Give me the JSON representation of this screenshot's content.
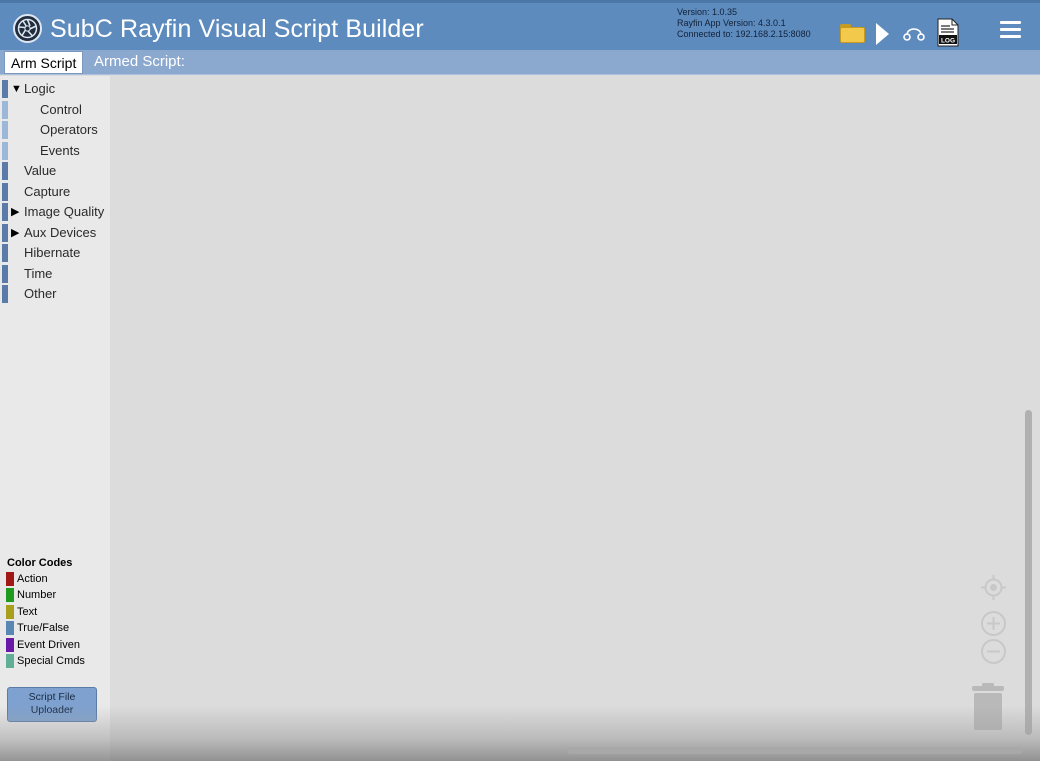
{
  "header": {
    "title": "SubC Rayfin Visual Script Builder",
    "version": "Version: 1.0.35",
    "app_version": "Rayfin App Version: 4.3.0.1",
    "connected_to": "Connected to: 192.168.2.15:8080",
    "icons": [
      "folder-icon",
      "play-icon",
      "connection-icon",
      "log-icon",
      "menu-icon"
    ],
    "log_icon_text": "LOG"
  },
  "subbar": {
    "arm_script_label": "Arm Script",
    "armed_script_label": "Armed Script:"
  },
  "sidebar": {
    "categories": [
      {
        "label": "Logic",
        "expanded": true
      },
      {
        "label": "Control",
        "sub": true
      },
      {
        "label": "Operators",
        "sub": true
      },
      {
        "label": "Events",
        "sub": true
      },
      {
        "label": "Value"
      },
      {
        "label": "Capture"
      },
      {
        "label": "Image Quality",
        "expanded": false
      },
      {
        "label": "Aux Devices",
        "expanded": false
      },
      {
        "label": "Hibernate"
      },
      {
        "label": "Time"
      },
      {
        "label": "Other"
      }
    ],
    "arrows": {
      "expanded": "▼",
      "collapsed": "▶"
    },
    "color_codes": {
      "title": "Color Codes",
      "items": [
        {
          "label": "Action",
          "color": "#a01818"
        },
        {
          "label": "Number",
          "color": "#1f9a1f"
        },
        {
          "label": "Text",
          "color": "#a8a01a"
        },
        {
          "label": "True/False",
          "color": "#5a86b4"
        },
        {
          "label": "Event Driven",
          "color": "#6a18a8"
        },
        {
          "label": "Special Cmds",
          "color": "#5fae95"
        }
      ]
    },
    "uploader": {
      "line1": "Script File",
      "line2": "Uploader"
    }
  },
  "workspace": {
    "controls": [
      "recenter-icon",
      "zoom-in-icon",
      "zoom-out-icon",
      "trash-icon"
    ]
  },
  "colors": {
    "header": "#5d8bbd",
    "subbar": "#8ba8cf",
    "sidebar": "#e9e9e9",
    "workspace": "#dcdcdc"
  }
}
